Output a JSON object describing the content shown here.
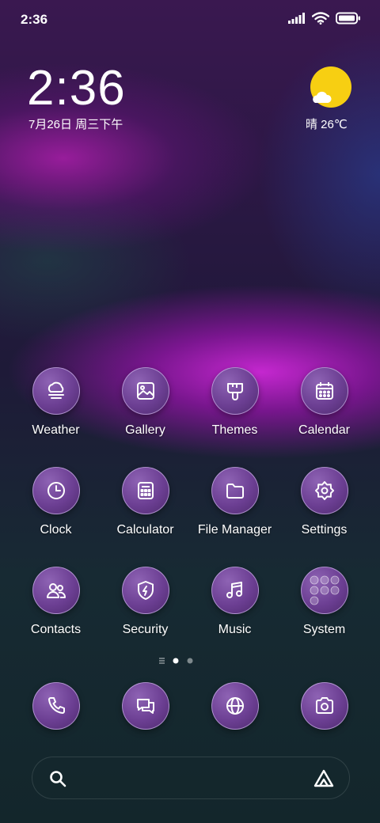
{
  "status_bar": {
    "time": "2:36"
  },
  "lock_clock": {
    "time": "2:36",
    "date": "7月26日 周三下午"
  },
  "weather": {
    "text": "晴 26℃"
  },
  "apps": [
    {
      "label": "Weather",
      "icon": "weather-icon"
    },
    {
      "label": "Gallery",
      "icon": "gallery-icon"
    },
    {
      "label": "Themes",
      "icon": "themes-icon"
    },
    {
      "label": "Calendar",
      "icon": "calendar-icon"
    },
    {
      "label": "Clock",
      "icon": "clock-icon"
    },
    {
      "label": "Calculator",
      "icon": "calculator-icon"
    },
    {
      "label": "File Manager",
      "icon": "folder-icon"
    },
    {
      "label": "Settings",
      "icon": "gear-icon"
    },
    {
      "label": "Contacts",
      "icon": "contacts-icon"
    },
    {
      "label": "Security",
      "icon": "shield-icon"
    },
    {
      "label": "Music",
      "icon": "music-icon"
    },
    {
      "label": "System",
      "icon": "folder-grid-icon"
    }
  ],
  "dock": [
    {
      "icon": "phone-icon"
    },
    {
      "icon": "messages-icon"
    },
    {
      "icon": "browser-icon"
    },
    {
      "icon": "camera-icon"
    }
  ],
  "page_indicator": {
    "pages": 2,
    "active": 0
  },
  "colors": {
    "icon_fill": "#6c3f93",
    "sun": "#f7cf12"
  }
}
